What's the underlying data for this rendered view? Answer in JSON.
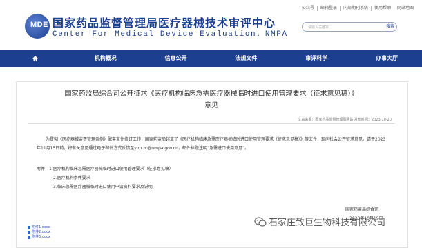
{
  "top_links": [
    "公众号",
    "邮箱登录",
    "内部期刊系统",
    "使用帮助",
    "网站地图"
  ],
  "brand": {
    "logo_mark": "MDE",
    "name_cn": "国家药品监督管理局医疗器械技术审评中心",
    "name_en": "Center For Medical Device Evaluation．NMPA"
  },
  "search": {
    "placeholder": "请输入关键字",
    "button_label": "搜索"
  },
  "nav": {
    "items": [
      "机构概况",
      "信息公开",
      "法规文件",
      "审评科学",
      "办事大厅"
    ]
  },
  "article": {
    "title_line1": "国家药监局综合司公开征求《医疗机构临床急需医疗器械临时进口使用管理要求（征求意见稿）》",
    "title_line2": "意见",
    "source": "文章来源：国家药品监督管理局网站 发布时间：2023-10-20",
    "paragraph": "为贯彻《医疗器械监督管理条例》配套文件修订工作，国家药监局起草了《医疗机构临床急需医疗器械临时进口使用管理要求（征求意见稿）》等文件，现向社会公开征求意见。请于2023年11月15日前，将有关意见通过电子邮件方式反馈至ylqxzc@nmpa.gov.cn，邮件标题注明“急需进口使用意见”。",
    "attachments": [
      "附件：1.医疗机构临床急需医疗器械临时进口使用管理要求（征求意见稿）",
      "2.医疗机构条件要求",
      "3.临床急需医疗器械临时进口使用申请资料要求及说明"
    ],
    "signature": "国家药监局综合司",
    "sign_date": "2023年10月19日",
    "files": [
      "附件1.docx",
      "附件2.docx",
      "附件3.docx"
    ]
  },
  "watermark": "石家庄致巨生物科技有限公司",
  "colors": {
    "nav_bg": "#1c3f8f",
    "brand": "#1d3f8f",
    "link": "#2a4db0"
  }
}
